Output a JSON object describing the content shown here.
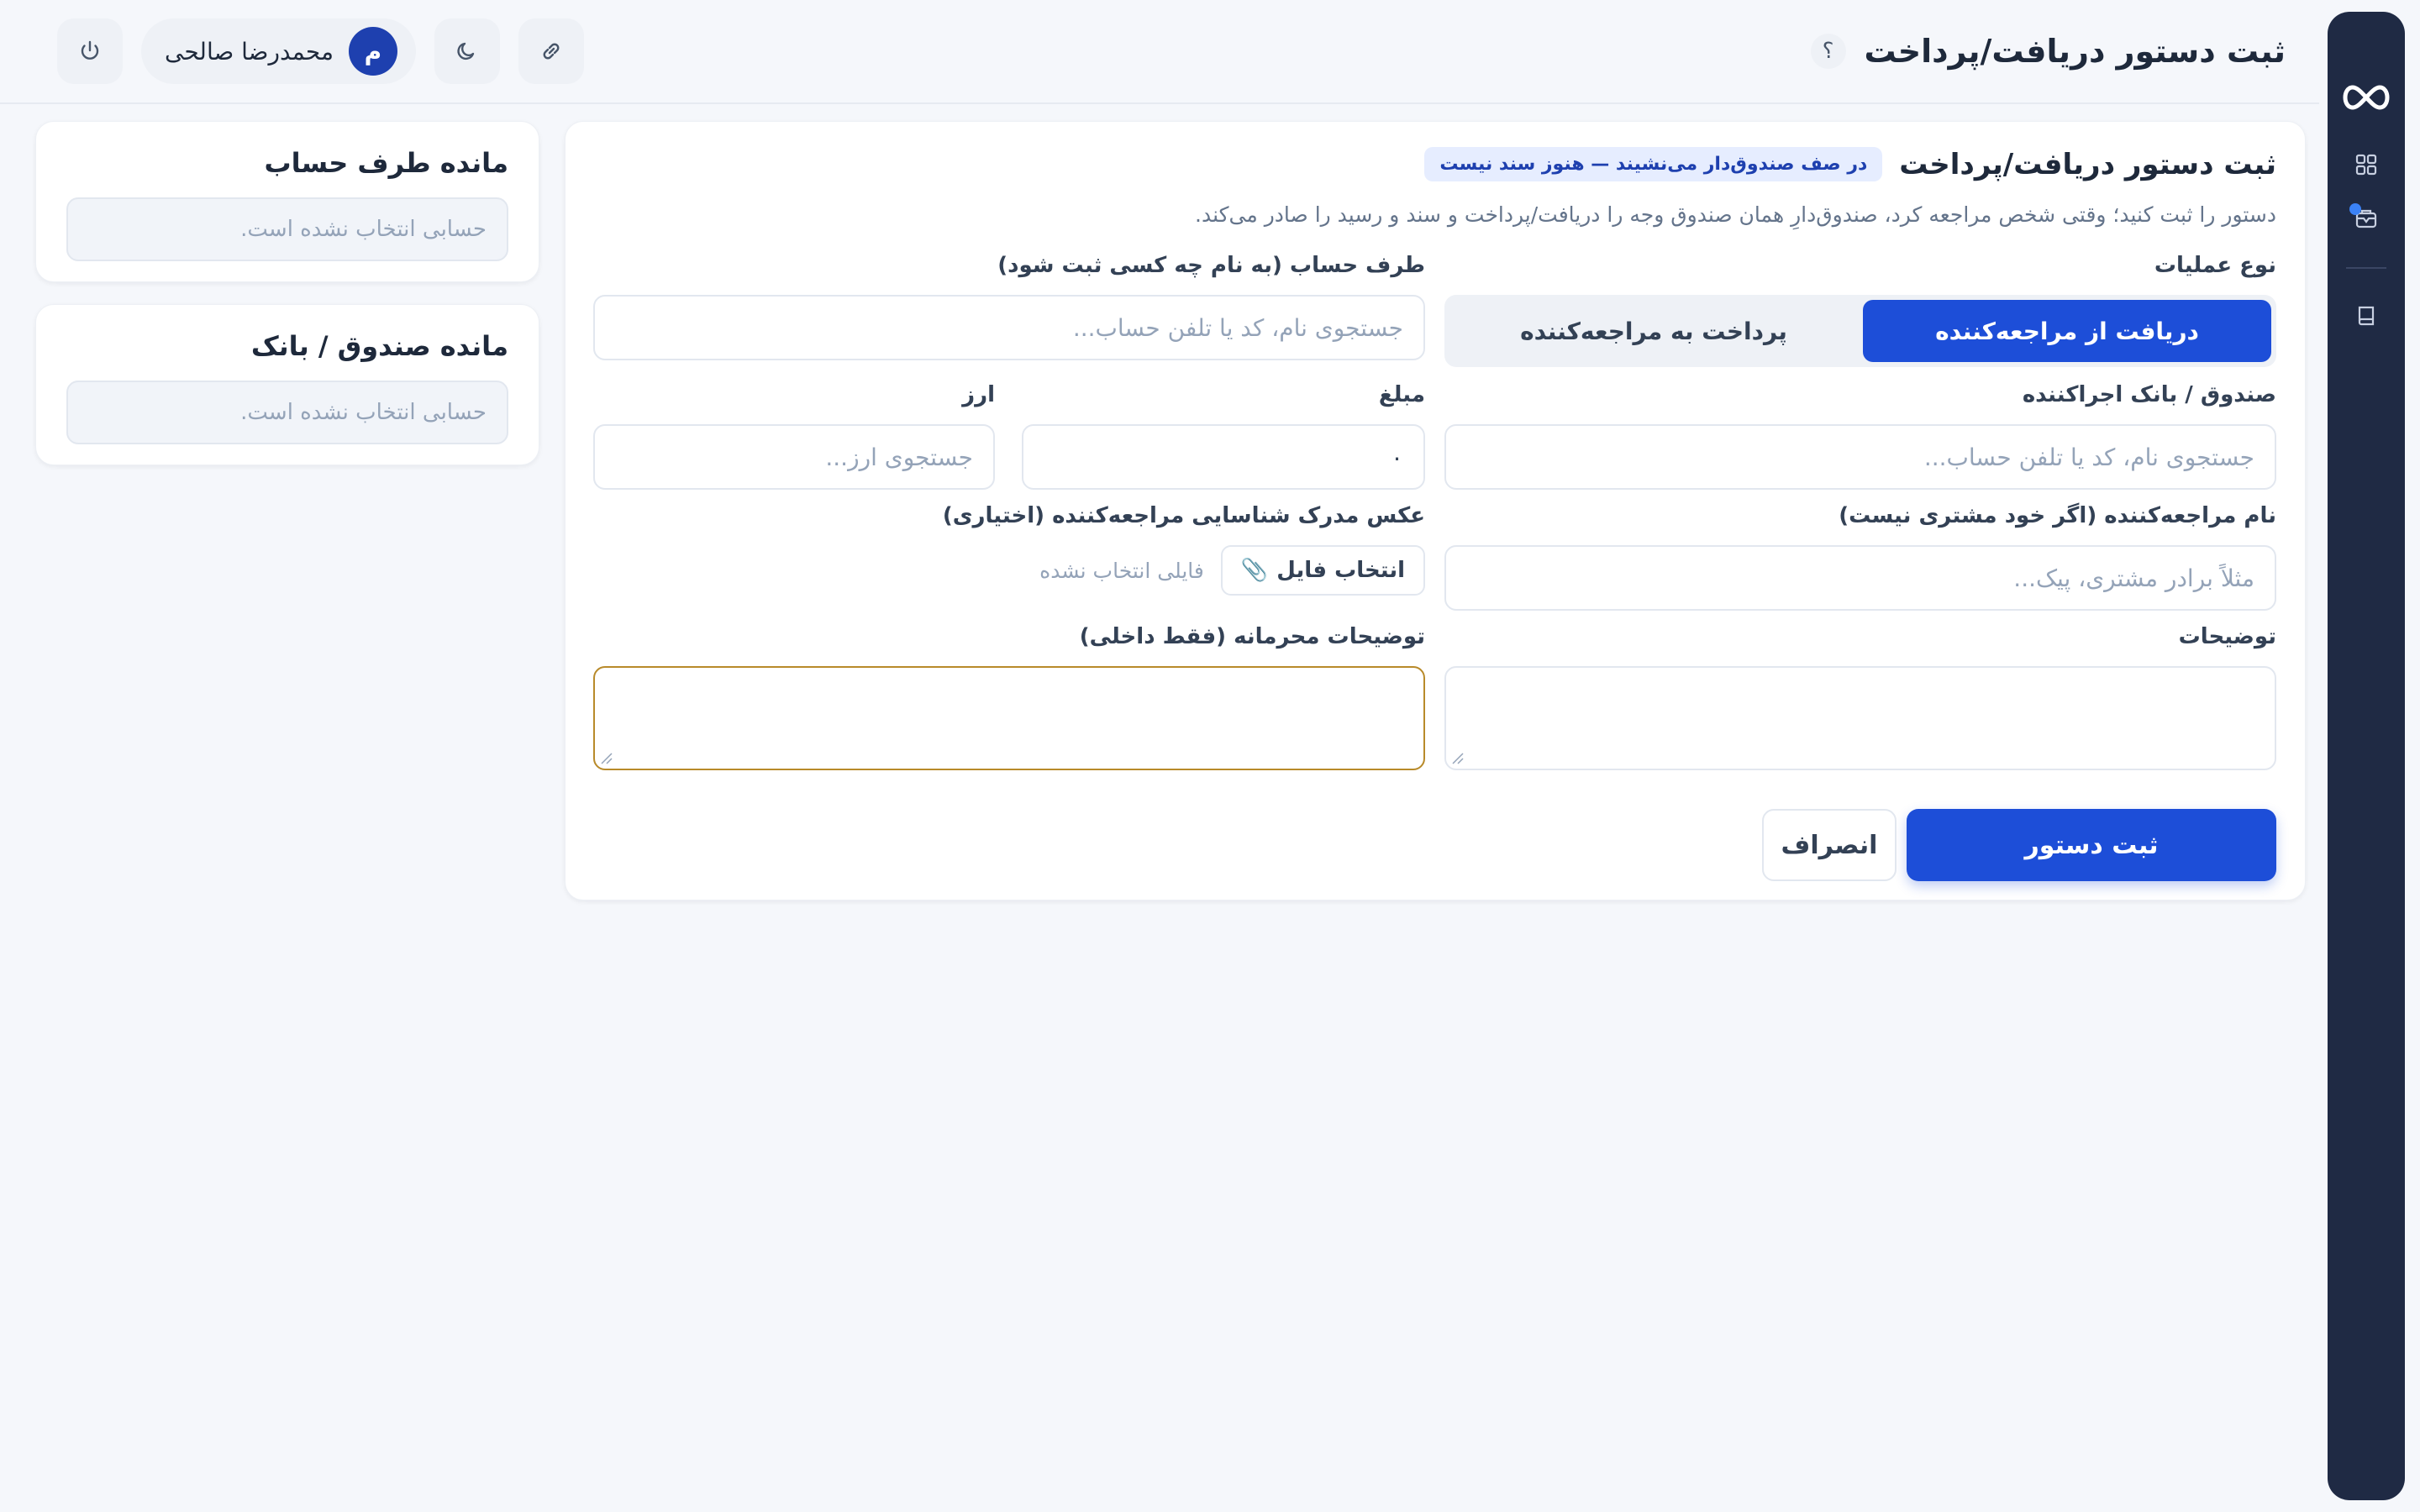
{
  "header": {
    "title": "ثبت دستور دریافت/پرداخت",
    "help_label": "؟",
    "user_name": "محمدرضا صالحی",
    "user_initial": "م"
  },
  "sidebar": {
    "items": [
      {
        "icon": "logo-infinity-icon"
      },
      {
        "icon": "grid-dashboard-icon"
      },
      {
        "icon": "cash-order-icon",
        "has_notification": true
      },
      {
        "icon": "book-icon"
      }
    ]
  },
  "form": {
    "title": "ثبت دستور دریافت/پرداخت",
    "badge": "در صف صندوق‌دار می‌نشیند — هنوز سند نیست",
    "description": "دستور را ثبت کنید؛ وقتی شخص مراجعه کرد، صندوق‌دارِ همان صندوق وجه را دریافت/پرداخت و سند و رسید را صادر می‌کند.",
    "operation_type_label": "نوع عملیات",
    "operation_options": [
      "دریافت از مراجعه‌کننده",
      "پرداخت به مراجعه‌کننده"
    ],
    "operation_selected": "دریافت از مراجعه‌کننده",
    "counterparty_label": "طرف حساب (به نام چه کسی ثبت شود)",
    "counterparty_placeholder": "جستجوی نام، کد یا تلفن حساب...",
    "cashbox_label": "صندوق / بانک اجراکننده",
    "cashbox_placeholder": "جستجوی نام، کد یا تلفن حساب...",
    "amount_label": "مبلغ",
    "amount_value": "۰",
    "currency_label": "ارز",
    "currency_placeholder": "جستجوی ارز...",
    "visitor_name_label": "نام مراجعه‌کننده (اگر خود مشتری نیست)",
    "visitor_name_placeholder": "مثلاً برادر مشتری، پیک...",
    "id_photo_label": "عکس مدرک شناسایی مراجعه‌کننده (اختیاری)",
    "file_button": "انتخاب فایل",
    "file_status": "فایلی انتخاب نشده",
    "notes_label": "توضیحات",
    "private_notes_label": "توضیحات محرمانه (فقط داخلی)",
    "submit_label": "ثبت دستور",
    "cancel_label": "انصراف"
  },
  "balances": {
    "counterparty_title": "مانده طرف حساب",
    "counterparty_empty": "حسابی انتخاب نشده است.",
    "cashbox_title": "مانده صندوق / بانک",
    "cashbox_empty": "حسابی انتخاب نشده است."
  },
  "colors": {
    "primary": "#1d4ed8",
    "sidebar": "#1f2a44",
    "focus_border": "#b88a2a",
    "notification_dot": "#3b82f6"
  }
}
